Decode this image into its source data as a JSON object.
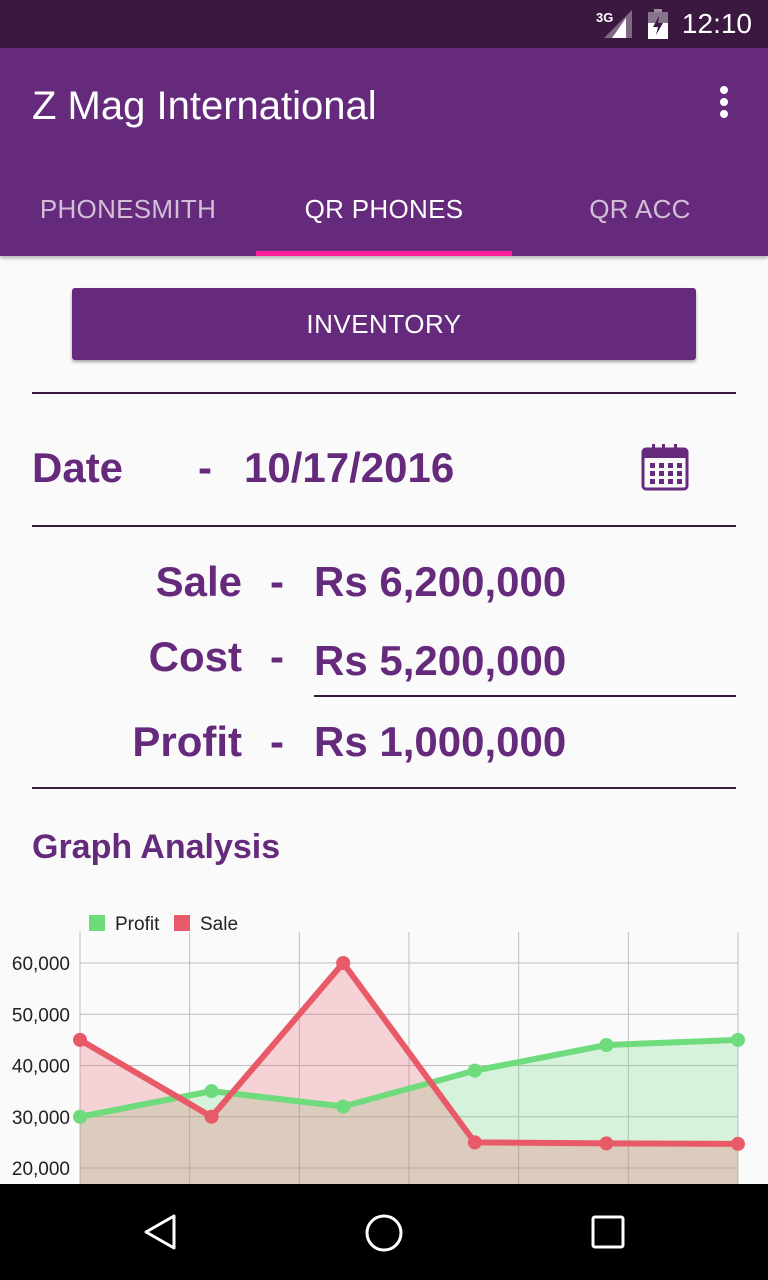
{
  "status_bar": {
    "network": "3G",
    "time": "12:10"
  },
  "app_bar": {
    "title": "Z Mag International",
    "tabs": [
      {
        "label": "PHONESMITH",
        "active": false
      },
      {
        "label": "QR PHONES",
        "active": true
      },
      {
        "label": "QR ACC",
        "active": false
      }
    ]
  },
  "content": {
    "inventory_label": "INVENTORY",
    "date": {
      "label": "Date",
      "separator": "-",
      "value": "10/17/2016"
    },
    "summary": [
      {
        "label": "Sale",
        "separator": "-",
        "value": "Rs 6,200,000"
      },
      {
        "label": "Cost",
        "separator": "-",
        "value": "Rs 5,200,000"
      },
      {
        "label": "Profit",
        "separator": "-",
        "value": "Rs 1,000,000"
      }
    ],
    "graph_title": "Graph Analysis"
  },
  "colors": {
    "primary": "#662a7c",
    "status_bar": "#3a1840",
    "tab_indicator": "#ff1f9d",
    "profit": "#6edb7c",
    "sale": "#e85a67"
  },
  "chart_data": {
    "type": "line",
    "x": [
      0,
      1,
      2,
      3,
      4,
      5
    ],
    "series": [
      {
        "name": "Profit",
        "values": [
          30000,
          35000,
          32000,
          39000,
          44000,
          45000
        ],
        "color": "#6edb7c"
      },
      {
        "name": "Sale",
        "values": [
          45000,
          30000,
          60000,
          25000,
          24800,
          24700
        ],
        "color": "#e85a67"
      }
    ],
    "y_ticks": [
      "60,000",
      "50,000",
      "40,000",
      "30,000",
      "20,000"
    ],
    "y_tick_values": [
      60000,
      50000,
      40000,
      30000,
      20000
    ],
    "ylim": [
      15000,
      65000
    ],
    "legend_position": "top-left",
    "grid": true
  }
}
